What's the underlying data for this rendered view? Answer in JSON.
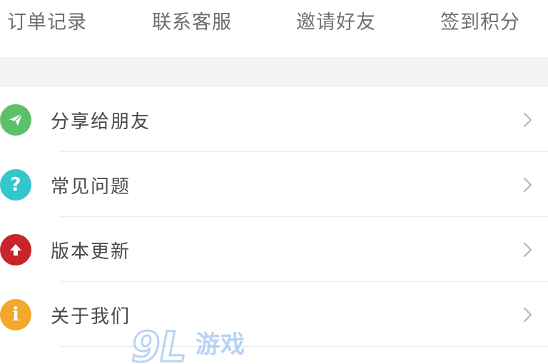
{
  "top_nav": {
    "items": [
      {
        "label": "订单记录"
      },
      {
        "label": "联系客服"
      },
      {
        "label": "邀请好友"
      },
      {
        "label": "签到积分"
      }
    ]
  },
  "menu": {
    "items": [
      {
        "label": "分享给朋友",
        "icon": "paper-plane-icon",
        "color": "#5cc06a"
      },
      {
        "label": "常见问题",
        "icon": "question-icon",
        "color": "#35c5cc",
        "glyph": "?"
      },
      {
        "label": "版本更新",
        "icon": "arrow-up-icon",
        "color": "#c8242b"
      },
      {
        "label": "关于我们",
        "icon": "info-icon",
        "color": "#f2a82c",
        "glyph": "i"
      }
    ]
  },
  "watermark": {
    "number": "9L",
    "text": "游戏"
  },
  "colors": {
    "section_gap": "#f3f3f3",
    "text": "#4a4a4a",
    "nav_text": "#6f6f6f"
  }
}
